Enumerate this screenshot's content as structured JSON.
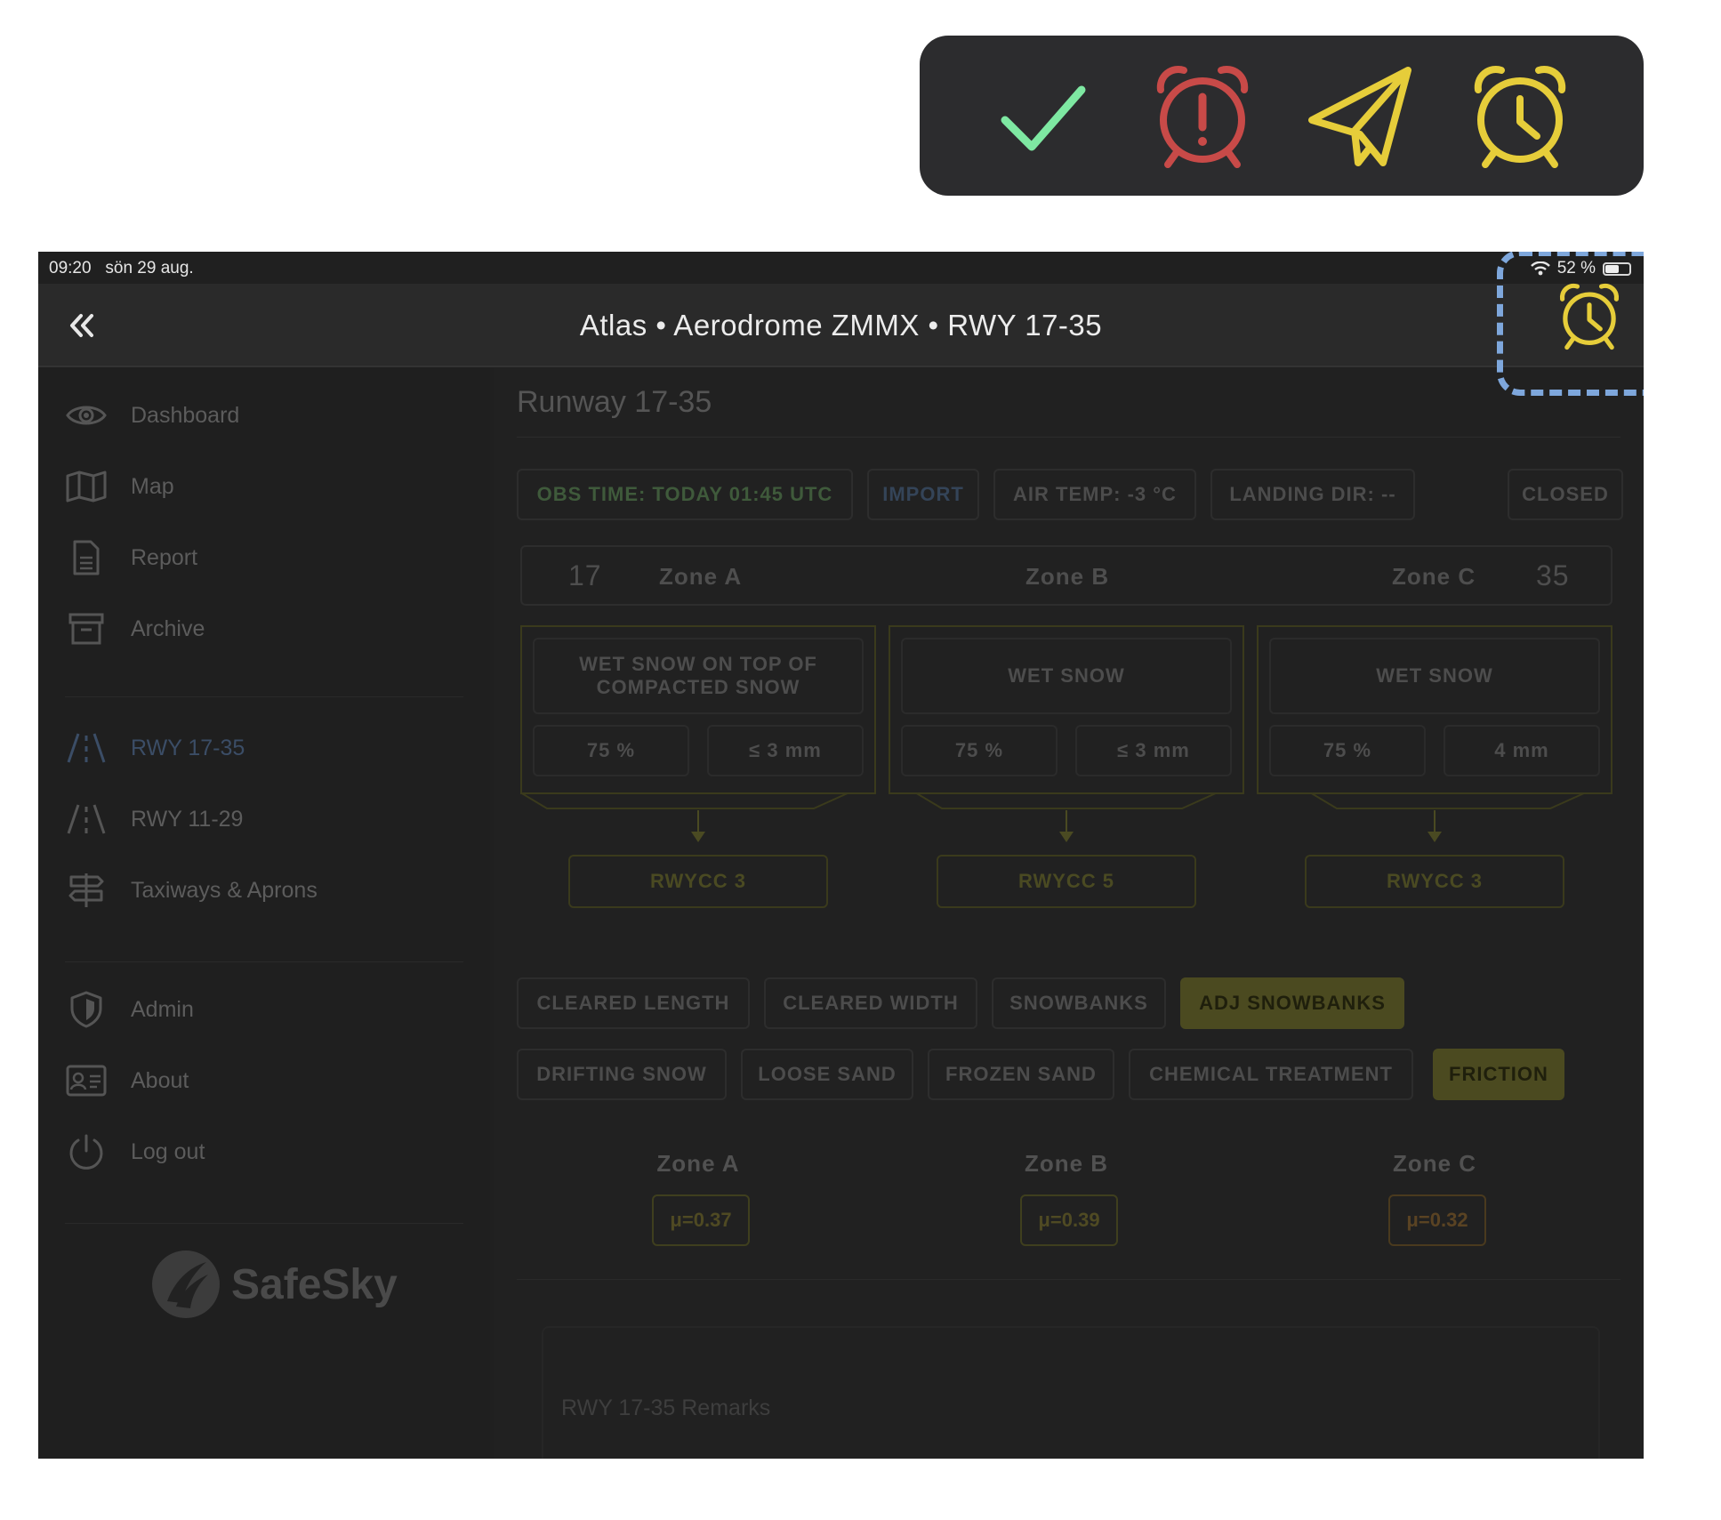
{
  "legend": {
    "icons": [
      "check-icon",
      "alarm-alert-icon",
      "send-icon",
      "alarm-clock-icon"
    ],
    "colors": {
      "check": "#7ee8a2",
      "alert": "#c84a48",
      "send": "#e6cd3a",
      "clock": "#e6cd3a"
    }
  },
  "status_bar": {
    "time": "09:20",
    "date": "sön 29 aug.",
    "battery": "52 %"
  },
  "header": {
    "title": "Atlas • Aerodrome ZMMX • RWY 17-35",
    "back_icon": "double-chevron-left-icon",
    "status_icon": "alarm-clock-icon"
  },
  "sidebar": {
    "items": [
      {
        "label": "Dashboard",
        "icon": "eye-icon"
      },
      {
        "label": "Map",
        "icon": "map-icon"
      },
      {
        "label": "Report",
        "icon": "document-icon"
      },
      {
        "label": "Archive",
        "icon": "archive-icon"
      },
      {
        "label": "RWY 17-35",
        "icon": "runway-icon",
        "active": true
      },
      {
        "label": "RWY 11-29",
        "icon": "runway-icon"
      },
      {
        "label": "Taxiways & Aprons",
        "icon": "signpost-icon"
      },
      {
        "label": "Admin",
        "icon": "shield-icon"
      },
      {
        "label": "About",
        "icon": "id-card-icon"
      },
      {
        "label": "Log out",
        "icon": "power-icon"
      }
    ],
    "logo": "SafeSky"
  },
  "main": {
    "title": "Runway 17-35",
    "chips": {
      "obs_time": "OBS TIME: TODAY 01:45 UTC",
      "import": "IMPORT",
      "air_temp": "AIR TEMP: -3 °C",
      "landing_dir": "LANDING DIR: --",
      "closed": "CLOSED"
    },
    "zone_header": {
      "start": "17",
      "a": "Zone A",
      "b": "Zone B",
      "c": "Zone C",
      "end": "35"
    },
    "zones": [
      {
        "desc": "WET SNOW ON TOP OF COMPACTED SNOW",
        "coverage": "75 %",
        "depth": "≤ 3 mm",
        "rwycc": "RWYCC 3"
      },
      {
        "desc": "WET SNOW",
        "coverage": "75 %",
        "depth": "≤ 3 mm",
        "rwycc": "RWYCC 5"
      },
      {
        "desc": "WET SNOW",
        "coverage": "75 %",
        "depth": "4 mm",
        "rwycc": "RWYCC 3"
      }
    ],
    "options_row1": [
      "CLEARED LENGTH",
      "CLEARED WIDTH",
      "SNOWBANKS",
      "ADJ SNOWBANKS"
    ],
    "options_row2": [
      "DRIFTING SNOW",
      "LOOSE SAND",
      "FROZEN SAND",
      "CHEMICAL TREATMENT",
      "FRICTION"
    ],
    "friction": {
      "zones": [
        "Zone A",
        "Zone B",
        "Zone C"
      ],
      "values": [
        "μ=0.37",
        "μ=0.39",
        "μ=0.32"
      ]
    },
    "remarks_placeholder": "RWY 17-35 Remarks"
  }
}
